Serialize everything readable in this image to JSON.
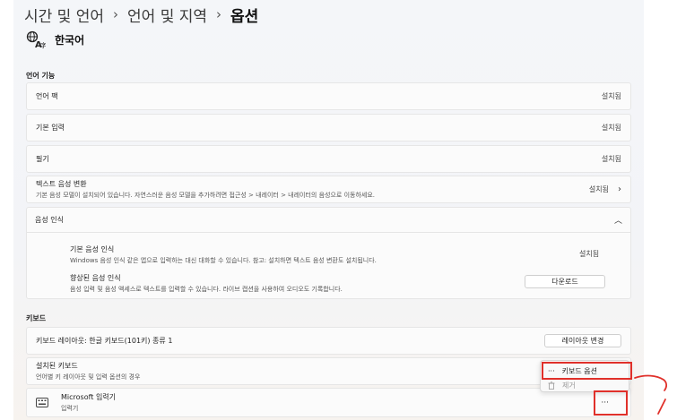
{
  "breadcrumb": {
    "item1": "시간 및 언어",
    "item2": "언어 및 지역",
    "current": "옵션",
    "separator": "›"
  },
  "language": {
    "name": "한국어",
    "icon": "language-icon"
  },
  "language_features": {
    "section_label": "언어 기능",
    "rows": [
      {
        "label": "언어 팩",
        "status": "설치됨"
      },
      {
        "label": "기본 입력",
        "status": "설치됨"
      },
      {
        "label": "필기",
        "status": "설치됨"
      }
    ],
    "tts": {
      "title": "텍스트 음성 변환",
      "description": "기본 음성 모델이 설치되어 있습니다. 자연스러운 음성 모델을 추가하려면 접근성 > 내레이터 > 내레이터의 음성으로 이동하세요.",
      "status": "설치됨"
    },
    "speech": {
      "title": "음성 인식",
      "basic_title": "기본 음성 인식",
      "basic_desc": "Windows 음성 인식 같은 앱으로 입력하는 대신 대화할 수 있습니다. 참고: 설치하면 텍스트 음성 변환도 설치됩니다.",
      "basic_status": "설치됨",
      "enhanced_title": "향상된 음성 인식",
      "enhanced_desc": "음성 입력 및 음성 액세스로 텍스트를 입력할 수 있습니다. 라이브 캡션을 사용하여 오디오도 기록합니다.",
      "download_label": "다운로드"
    }
  },
  "keyboard": {
    "section_label": "키보드",
    "layout_label": "키보드 레이아웃: 한글 키보드(101키) 종류 1",
    "layout_change_button": "레이아웃 변경",
    "installed_title": "설치된 키보드",
    "installed_desc": "언어별 키 레이아웃 및 입력 옵션의 경우",
    "ime_name": "Microsoft 입력기",
    "ime_type": "입력기",
    "more_label": "···"
  },
  "popup_menu": {
    "keyboard_options": "키보드 옵션",
    "keyboard_options_icon": "···",
    "remove": "제거"
  },
  "colors": {
    "annotation_red": "#e0302a"
  }
}
